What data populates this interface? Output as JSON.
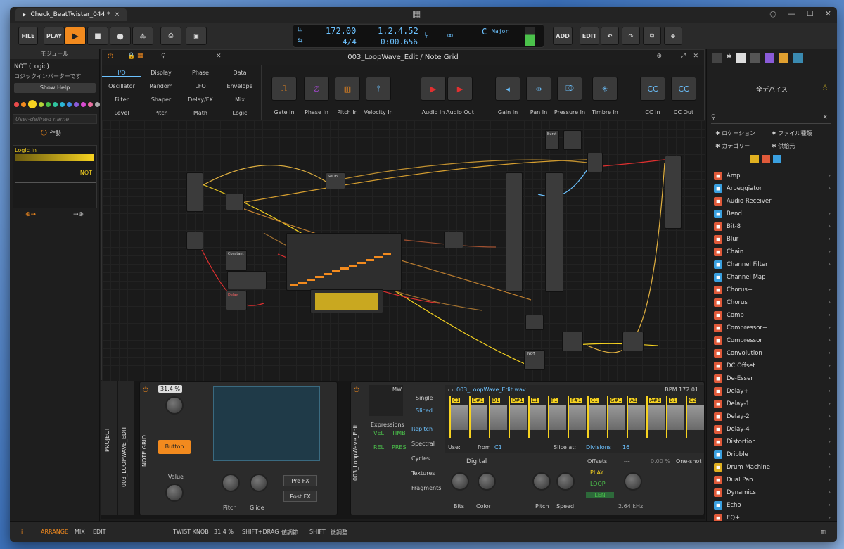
{
  "window": {
    "tab_title": "Check_BeatTwister_044 *",
    "close": "×"
  },
  "toolbar": {
    "file": "FILE",
    "play": "PLAY",
    "add": "ADD",
    "edit": "EDIT",
    "tempo": "172.00",
    "time_sig": "4/4",
    "position": "1.2.4.52",
    "time": "0:00.656",
    "key_root": "C",
    "key_scale": "Major"
  },
  "left_panel": {
    "title": "モジュール",
    "module_name": "NOT (Logic)",
    "module_desc": "ロジックインバーターです",
    "show_help": "Show Help",
    "user_name_placeholder": "User-defined name",
    "action": "作動",
    "logic_in": "Logic In",
    "not_label": "NOT",
    "color_dots": [
      "#e84b4b",
      "#f28a1e",
      "#f7d320",
      "#b6d43a",
      "#49c24b",
      "#2fc4a0",
      "#2ab6d6",
      "#3f8ee8",
      "#8a5bd8",
      "#d94bd1",
      "#e86fa0",
      "#aaaaaa"
    ]
  },
  "editor": {
    "title": "003_LoopWave_Edit / Note Grid",
    "categories": [
      [
        "I/O",
        "Display",
        "Phase",
        "Data"
      ],
      [
        "Oscillator",
        "Random",
        "LFO",
        "Envelope"
      ],
      [
        "Filter",
        "Shaper",
        "Delay/FX",
        "Mix"
      ],
      [
        "Level",
        "Pitch",
        "Math",
        "Logic"
      ]
    ],
    "modules": [
      "Gate In",
      "Phase In",
      "Pitch In",
      "Velocity In",
      "Audio In",
      "Audio Out",
      "Gain In",
      "Pan In",
      "Pressure In",
      "Timbre In",
      "CC In",
      "CC Out"
    ],
    "nodes": {
      "sel_in": "Sel In",
      "constant": "Constant",
      "delay": "Delay",
      "not": "NOT",
      "burst": "Burst"
    }
  },
  "right_panel": {
    "header": "全デバイス",
    "filters": [
      "ロケーション",
      "ファイル種類",
      "カテゴリー",
      "供給元"
    ],
    "devices": [
      {
        "name": "Amp",
        "color": "#e05a3a",
        "chev": true
      },
      {
        "name": "Arpeggiator",
        "color": "#3aa0e0",
        "chev": true
      },
      {
        "name": "Audio Receiver",
        "color": "#e05a3a",
        "chev": false
      },
      {
        "name": "Bend",
        "color": "#3aa0e0",
        "chev": true
      },
      {
        "name": "Bit-8",
        "color": "#e05a3a",
        "chev": true
      },
      {
        "name": "Blur",
        "color": "#e05a3a",
        "chev": true
      },
      {
        "name": "Chain",
        "color": "#e05a3a",
        "chev": true
      },
      {
        "name": "Channel Filter",
        "color": "#3aa0e0",
        "chev": true
      },
      {
        "name": "Channel Map",
        "color": "#3aa0e0",
        "chev": false
      },
      {
        "name": "Chorus+",
        "color": "#e05a3a",
        "chev": true
      },
      {
        "name": "Chorus",
        "color": "#e05a3a",
        "chev": true
      },
      {
        "name": "Comb",
        "color": "#e05a3a",
        "chev": true
      },
      {
        "name": "Compressor+",
        "color": "#e05a3a",
        "chev": true
      },
      {
        "name": "Compressor",
        "color": "#e05a3a",
        "chev": true
      },
      {
        "name": "Convolution",
        "color": "#e05a3a",
        "chev": true
      },
      {
        "name": "DC Offset",
        "color": "#e05a3a",
        "chev": true
      },
      {
        "name": "De-Esser",
        "color": "#e05a3a",
        "chev": true
      },
      {
        "name": "Delay+",
        "color": "#e05a3a",
        "chev": true
      },
      {
        "name": "Delay-1",
        "color": "#e05a3a",
        "chev": true
      },
      {
        "name": "Delay-2",
        "color": "#e05a3a",
        "chev": true
      },
      {
        "name": "Delay-4",
        "color": "#e05a3a",
        "chev": true
      },
      {
        "name": "Distortion",
        "color": "#e05a3a",
        "chev": true
      },
      {
        "name": "Dribble",
        "color": "#3aa0e0",
        "chev": true
      },
      {
        "name": "Drum Machine",
        "color": "#e0b020",
        "chev": true
      },
      {
        "name": "Dual Pan",
        "color": "#e05a3a",
        "chev": true
      },
      {
        "name": "Dynamics",
        "color": "#e05a3a",
        "chev": true
      },
      {
        "name": "Echo",
        "color": "#3aa0e0",
        "chev": true
      },
      {
        "name": "EQ+",
        "color": "#e05a3a",
        "chev": true
      }
    ]
  },
  "bottom": {
    "project": "PROJECT",
    "track": "003_LOOPWAVE_EDIT",
    "note_grid": "NOTE GRID",
    "loopwave": "003_LoopWave_Edit",
    "value_pct": "31.4 %",
    "button": "Button",
    "value": "Value",
    "pitch": "Pitch",
    "glide": "Glide",
    "pre_fx": "Pre FX",
    "post_fx": "Post FX",
    "mw": "MW",
    "single": "Single",
    "sliced": "Sliced",
    "expressions": "Expressions",
    "vel": "VEL",
    "timb": "TIMB",
    "rel": "REL",
    "pres": "PRES",
    "modes": [
      "Repitch",
      "Spectral",
      "Cycles",
      "Textures",
      "Fragments"
    ],
    "file": "003_LoopWave_Edit.wav",
    "bpm": "BPM 172.01",
    "slices": [
      "C1",
      "C#1",
      "D1",
      "D#1",
      "E1",
      "F1",
      "F#1",
      "G1",
      "G#1",
      "A1",
      "A#1",
      "B1",
      "C2"
    ],
    "use": "Use:",
    "from": "from",
    "from_note": "C1",
    "slice_at": "Slice at:",
    "divisions": "Divisions",
    "div_count": "16",
    "digital": "Digital",
    "bits": "Bits",
    "color": "Color",
    "speed": "Speed",
    "offsets": "Offsets",
    "play": "PLAY",
    "loop": "LOOP",
    "len": "LEN",
    "freq": "2.64 kHz",
    "pct": "0.00 %",
    "oneshot": "One-shot",
    "dash": "---"
  },
  "status": {
    "arrange": "ARRANGE",
    "mix": "MIX",
    "edit": "EDIT",
    "twist": "TWIST KNOB",
    "twist_val": "31.4 %",
    "shift_drag": "SHIFT+DRAG",
    "shift_drag_desc": "値調節",
    "shift": "SHIFT",
    "shift_desc": "微調整"
  }
}
